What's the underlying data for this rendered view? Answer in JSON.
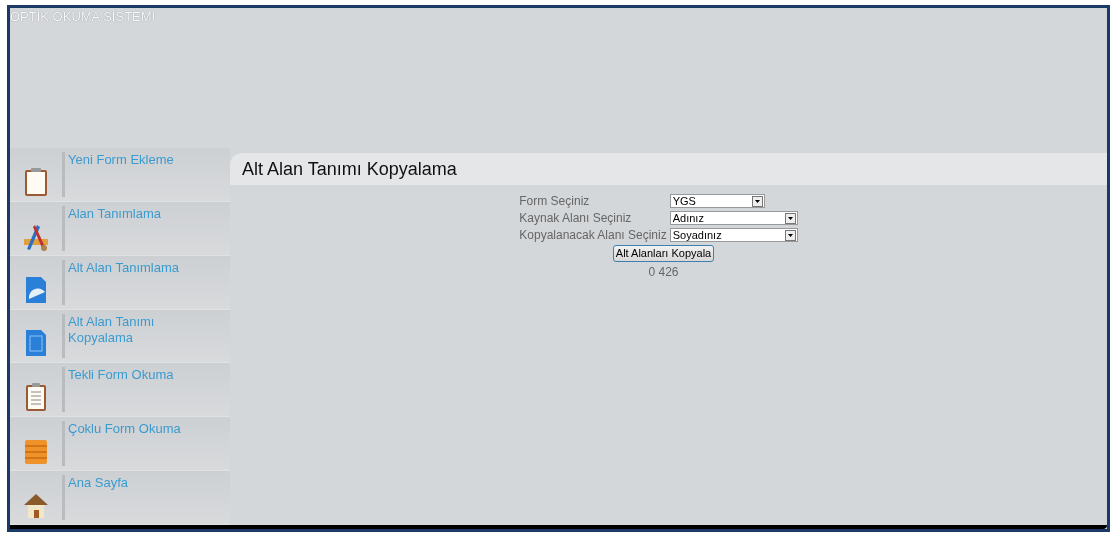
{
  "header": {
    "title": "OPTİK OKUMA SİSTEMİ"
  },
  "sidebar": {
    "items": [
      {
        "label": "Yeni Form Ekleme"
      },
      {
        "label": "Alan Tanımlama"
      },
      {
        "label": "Alt Alan Tanımlama"
      },
      {
        "label": "Alt Alan Tanımı Kopyalama"
      },
      {
        "label": "Tekli Form Okuma"
      },
      {
        "label": "Çoklu Form Okuma"
      },
      {
        "label": "Ana Sayfa"
      }
    ]
  },
  "page": {
    "title": "Alt Alan Tanımı Kopyalama",
    "fields": [
      {
        "label": "Form Seçiniz",
        "value": "YGS",
        "wide": false
      },
      {
        "label": "Kaynak Alanı Seçiniz",
        "value": "Adınız",
        "wide": true
      },
      {
        "label": "Kopyalanacak Alanı Seçiniz",
        "value": "Soyadınız",
        "wide": true
      }
    ],
    "button": "Alt Alanları Kopyala",
    "result": "0 426"
  }
}
